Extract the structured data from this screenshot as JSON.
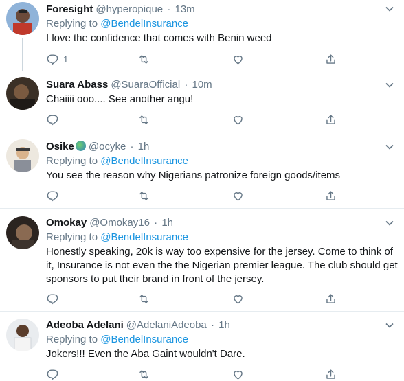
{
  "tweets": [
    {
      "name": "Foresight",
      "handle": "@hyperopique",
      "time": "13m",
      "replying_label": "Replying to",
      "replying_to": "@BendelInsurance",
      "text": "I love the confidence that comes with Benin weed",
      "reply_count": "1"
    },
    {
      "name": "Suara Abass",
      "handle": "@SuaraOfficial",
      "time": "10m",
      "text": "Chaiiii ooo.... See another angu!"
    },
    {
      "name": "Osike",
      "handle": "@ocyke",
      "time": "1h",
      "replying_label": "Replying to",
      "replying_to": "@BendelInsurance",
      "text": "You see the reason why Nigerians patronize foreign goods/items"
    },
    {
      "name": "Omokay",
      "handle": "@Omokay16",
      "time": "1h",
      "replying_label": "Replying to",
      "replying_to": "@BendelInsurance",
      "text": "Honestly speaking, 20k is way too expensive for the jersey. Come to think of it, Insurance is not even the the Nigerian premier league. The club should get sponsors to put their brand in front of the jersey."
    },
    {
      "name": "Adeoba Adelani",
      "handle": "@AdelaniAdeoba",
      "time": "1h",
      "replying_label": "Replying to",
      "replying_to": "@BendelInsurance",
      "text": "Jokers!!! Even the Aba Gaint wouldn't Dare."
    }
  ],
  "separator": "·",
  "icons": {
    "reply": "reply-icon",
    "retweet": "retweet-icon",
    "like": "like-icon",
    "share": "share-icon",
    "caret": "chevron-down-icon",
    "flag": "globe-emoji"
  },
  "colors": {
    "link": "#1b95e0",
    "secondary": "#657786",
    "text": "#14171a",
    "divider": "#e6ecf0"
  }
}
